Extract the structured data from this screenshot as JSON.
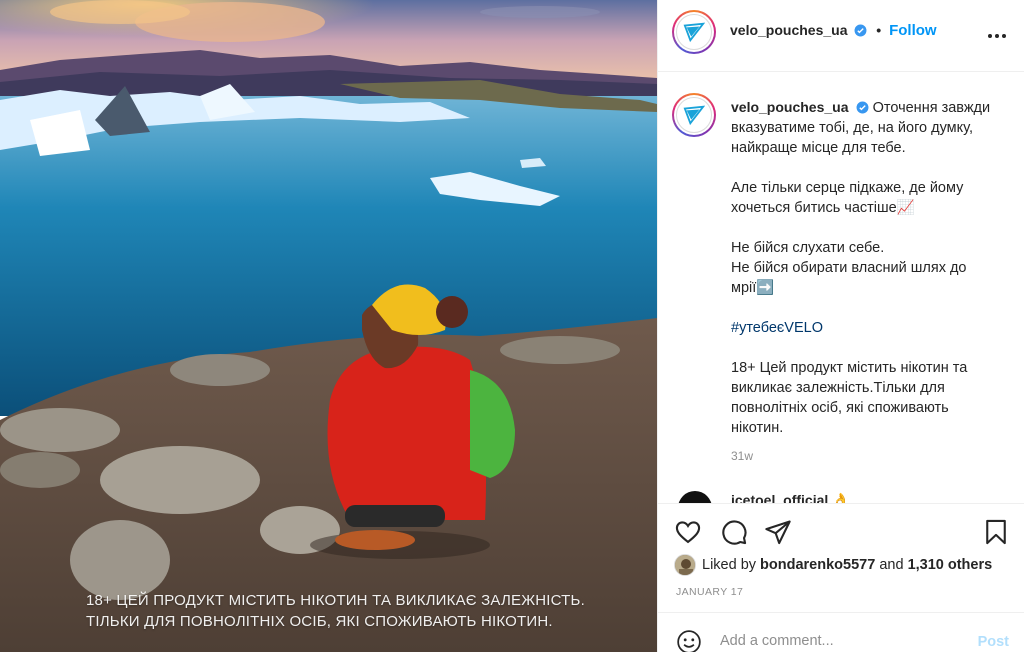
{
  "post": {
    "username": "velo_pouches_ua",
    "follow_label": "Follow",
    "separator": "•",
    "overlay_lines": [
      "18+ ЦЕЙ ПРОДУКТ МІСТИТЬ НІКОТИН ТА ВИКЛИКАЄ ЗАЛЕЖНІСТЬ.",
      "ТІЛЬКИ ДЛЯ ПОВНОЛІТНІХ ОСІБ, ЯКІ СПОЖИВАЮТЬ НІКОТИН."
    ]
  },
  "caption": {
    "username": "velo_pouches_ua",
    "lines_p1": [
      "Оточення завжди",
      "вказуватиме тобі, де, на його думку,",
      "найкраще місце для тебе."
    ],
    "lines_p2": [
      "Але тільки серце підкаже, де йому",
      "хочеться битись частіше📈"
    ],
    "lines_p3": [
      "Не бійся слухати себе.",
      "Не бійся обирати власний шлях до",
      "мрії➡️"
    ],
    "hashtag": "#утебеєVELO",
    "lines_p4": [
      "18+ Цей продукт містить нікотин та",
      "викликає залежність.Тільки для",
      "повнолітніх осіб, які споживають",
      "нікотин."
    ],
    "time_ago": "31w"
  },
  "next_comment": {
    "username": "icetoel_official 👌"
  },
  "likes": {
    "prefix": "Liked by",
    "user": "bondarenko5577",
    "and": "and",
    "count": "1,310 others"
  },
  "date": "JANUARY 17",
  "comment_box": {
    "placeholder": "Add a comment...",
    "post_label": "Post"
  },
  "icons": {
    "verified": "verified-badge-icon",
    "more": "more-options-icon",
    "like": "heart-icon",
    "comment": "comment-icon",
    "share": "share-icon",
    "save": "bookmark-icon",
    "emoji": "emoji-icon"
  },
  "colors": {
    "accent": "#0095f6",
    "hashtag": "#00376b",
    "muted": "#8e8e8e",
    "post_disabled": "#b2dffc"
  }
}
